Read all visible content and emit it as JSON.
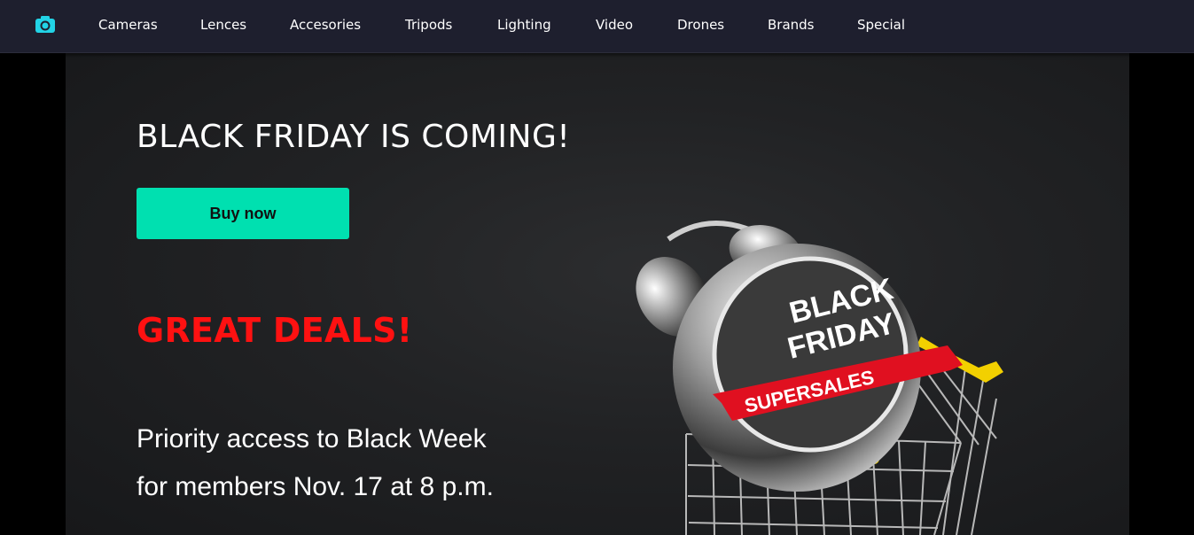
{
  "nav": {
    "logo_icon": "camera-icon",
    "items": [
      "Cameras",
      "Lences",
      "Accesories",
      "Tripods",
      "Lighting",
      "Video",
      "Drones",
      "Brands",
      "Special"
    ]
  },
  "hero": {
    "title": "BLACK FRIDAY IS COMING!",
    "button_label": "Buy now",
    "deals_text": "GREAT DEALS!",
    "priority_lines": [
      "Priority access to Black Week",
      "for members Nov. 17 at 8 p.m."
    ],
    "promo_image": {
      "clock_text_line1": "BLACK",
      "clock_text_line2": "FRIDAY",
      "ribbon_text": "SUPERSALES"
    }
  },
  "colors": {
    "navbar_bg": "#1e1f2e",
    "accent": "#00e0b0",
    "deals_red": "#ff1111",
    "ribbon_red": "#e01020",
    "cart_handle": "#f2d000"
  }
}
